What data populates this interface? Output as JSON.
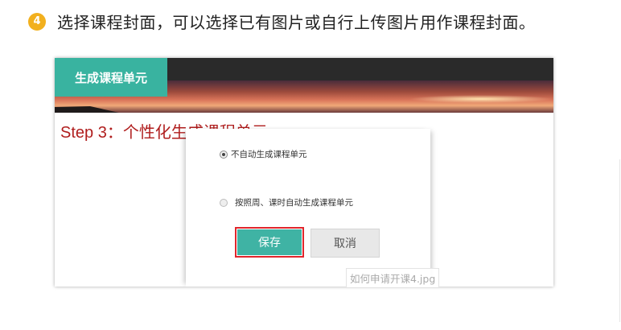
{
  "instruction": {
    "step_number": "4",
    "text": "选择课程封面，可以选择已有图片或自行上传图片用作课程封面。"
  },
  "screenshot": {
    "title_tab": "生成课程单元",
    "step_heading": "Step 3：个性化生成课程单元",
    "dialog": {
      "options": [
        {
          "label": "不自动生成课程单元",
          "selected": true
        },
        {
          "label": "按照周、课时自动生成课程单元",
          "selected": false
        }
      ],
      "save_label": "保存",
      "cancel_label": "取消"
    },
    "colors": {
      "accent": "#3fb3a4",
      "title_tab": "#39b3a0",
      "heading": "#b01e1e",
      "highlight_border": "#e0262c",
      "step_badge": "#f2b01e"
    }
  },
  "watermark": "如何申请开课4.jpg"
}
